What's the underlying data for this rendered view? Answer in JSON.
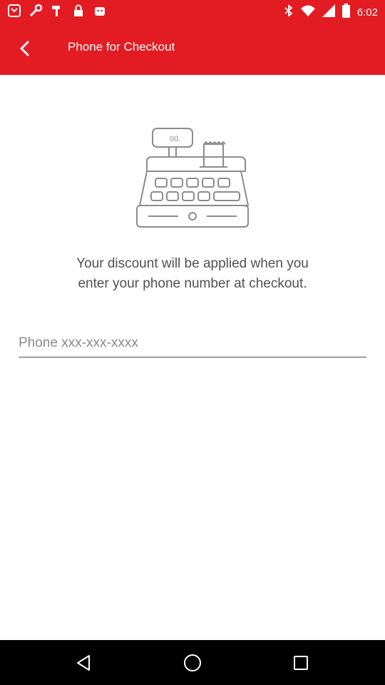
{
  "status_bar": {
    "time": "6:02",
    "left_icons": [
      "notification-icon",
      "wrench-icon",
      "hammer-icon",
      "lock-icon",
      "android-icon"
    ],
    "right_icons": [
      "bluetooth-icon",
      "wifi-icon",
      "signal-icon",
      "battery-icon"
    ]
  },
  "app_bar": {
    "title": "Phone for Checkout",
    "back_icon": "back-arrow-icon",
    "background_color": "#e31b23"
  },
  "main": {
    "illustration_icon": "cash-register-icon",
    "register_display_text": "00.",
    "message_line1": "Your discount will be applied when you",
    "message_line2": "enter your phone number at checkout.",
    "phone_input": {
      "placeholder": "Phone xxx-xxx-xxxx",
      "value": ""
    }
  },
  "nav_bar": {
    "buttons": [
      "back-nav-icon",
      "home-nav-icon",
      "recents-nav-icon"
    ]
  }
}
